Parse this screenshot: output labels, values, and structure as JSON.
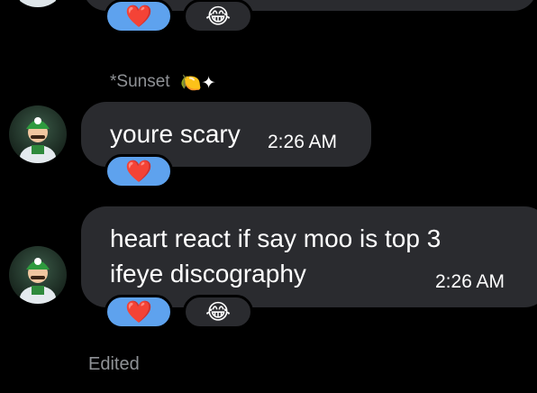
{
  "previous_message": {
    "avatar_name": "avatar",
    "reactions": [
      {
        "icon": "heart-icon",
        "glyph": "❤️"
      },
      {
        "icon": "tears-of-joy-icon",
        "glyph": "😂"
      }
    ]
  },
  "sender": {
    "name": "*Sunset",
    "badges": "🍋✦"
  },
  "messages": [
    {
      "lines": [
        "youre scary"
      ],
      "time": "2:26 AM",
      "reactions": [
        {
          "icon": "heart-icon",
          "glyph": "❤️"
        }
      ]
    },
    {
      "lines": [
        "heart react if say moo is top 3",
        "ifeye discography"
      ],
      "time": "2:26 AM",
      "reactions": [
        {
          "icon": "heart-icon",
          "glyph": "❤️"
        },
        {
          "icon": "tears-of-joy-icon",
          "glyph": "😂"
        }
      ]
    }
  ],
  "edited_label": "Edited",
  "colors": {
    "background": "#000000",
    "bubble": "#2a2b2f",
    "reaction_selected": "#5ea2ee",
    "muted_text": "#8f9296"
  }
}
